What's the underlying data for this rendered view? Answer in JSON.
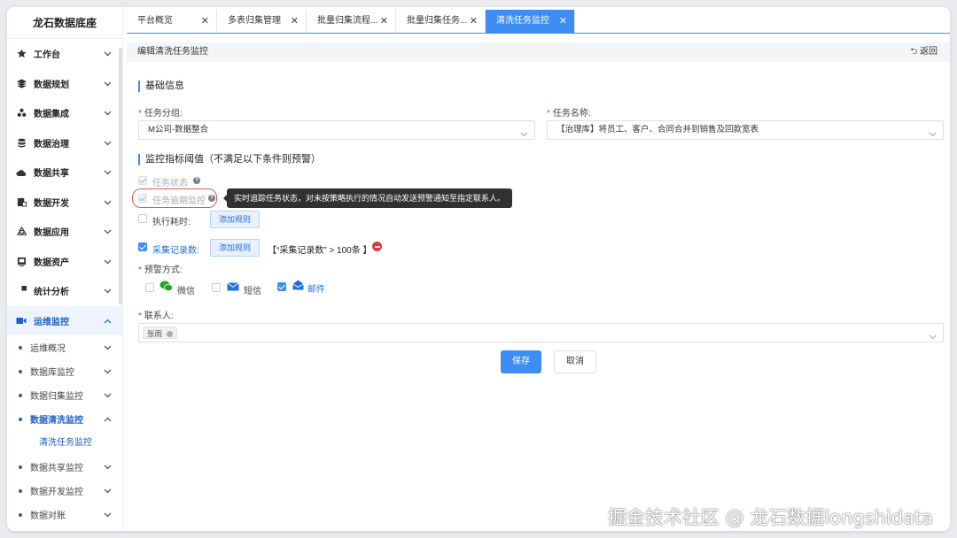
{
  "sidebar": {
    "brand": "龙石数据底座",
    "items": [
      {
        "label": "工作台",
        "icon": "star-icon"
      },
      {
        "label": "数据规划",
        "icon": "layers-icon"
      },
      {
        "label": "数据集成",
        "icon": "integration-icon"
      },
      {
        "label": "数据治理",
        "icon": "database-icon"
      },
      {
        "label": "数据共享",
        "icon": "cloud-icon"
      },
      {
        "label": "数据开发",
        "icon": "dev-icon"
      },
      {
        "label": "数据应用",
        "icon": "recycle-icon"
      },
      {
        "label": "数据资产",
        "icon": "asset-icon"
      },
      {
        "label": "统计分析",
        "icon": "pie-icon"
      },
      {
        "label": "运维监控",
        "icon": "video-icon"
      }
    ],
    "sub_items": [
      "运维概况",
      "数据库监控",
      "数据归集监控",
      "数据清洗监控",
      "数据共享监控",
      "数据开发监控",
      "数据对账"
    ],
    "leaf": "清洗任务监控"
  },
  "tabs": [
    {
      "label": "平台概览"
    },
    {
      "label": "多表归集管理"
    },
    {
      "label": "批量归集流程..."
    },
    {
      "label": "批量归集任务..."
    },
    {
      "label": "清洗任务监控"
    }
  ],
  "header": {
    "title": "编辑清洗任务监控",
    "back": "返回"
  },
  "form": {
    "basic_title": "基础信息",
    "group_label": "任务分组:",
    "group_value": "M公司-数据整合",
    "name_label": "任务名称:",
    "name_value": "【治理库】将员工、客户、合同合并到销售及回款宽表",
    "monitor_title": "监控指标阈值（不满足以下条件则预警）",
    "status_label": "任务状态",
    "overdue_label": "任务逾期监控",
    "tooltip": "实时追踪任务状态，对未按策略执行的情况自动发送预警通知至指定联系人。",
    "duration_label": "执行耗时:",
    "add_rule": "添加规则",
    "record_label": "采集记录数:",
    "rule_text": "【“采集记录数” > 100条 】",
    "alert_label": "预警方式:",
    "wechat": "微信",
    "sms": "短信",
    "mail": "邮件",
    "contact_label": "联系人:",
    "contact_tag": "张雨",
    "save": "保存",
    "cancel": "取消"
  },
  "watermark": "掘金技术社区 @ 龙石数据longshidata",
  "colors": {
    "accent": "#3d8df5",
    "danger": "#e53935",
    "wechat": "#1aad19"
  }
}
